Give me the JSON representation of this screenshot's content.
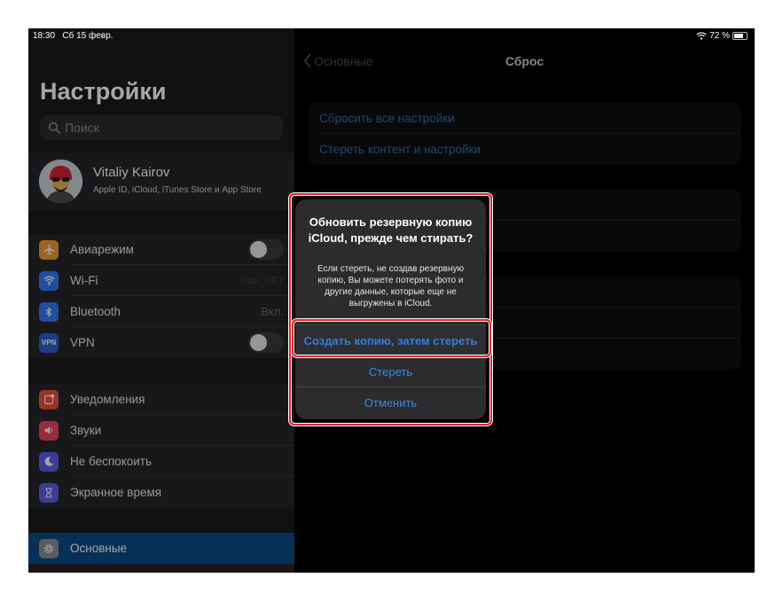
{
  "status_bar": {
    "time": "18:30",
    "date": "Сб 15 февр.",
    "battery": "72 %"
  },
  "sidebar": {
    "title": "Настройки",
    "search_placeholder": "Поиск",
    "profile": {
      "name": "Vitaliy Kairov",
      "subtitle": "Apple ID, iCloud, iTunes Store и App Store"
    },
    "group1": [
      {
        "label": "Авиарежим",
        "icon": "airplane-icon",
        "color": "#f09a37"
      },
      {
        "label": "Wi-Fi",
        "icon": "wifi-icon",
        "color": "#3478f6",
        "value": "Stan_NET"
      },
      {
        "label": "Bluetooth",
        "icon": "bluetooth-icon",
        "color": "#3478f6",
        "value": "Вкл."
      },
      {
        "label": "VPN",
        "icon": "vpn-icon",
        "color": "#2a5fd0",
        "badge": "VPN"
      }
    ],
    "group2": [
      {
        "label": "Уведомления",
        "icon": "notifications-icon",
        "color": "#eb4d3d"
      },
      {
        "label": "Звуки",
        "icon": "sounds-icon",
        "color": "#eb445a"
      },
      {
        "label": "Не беспокоить",
        "icon": "moon-icon",
        "color": "#5e5ce6"
      },
      {
        "label": "Экранное время",
        "icon": "hourglass-icon",
        "color": "#5e5ce6"
      }
    ],
    "group3": [
      {
        "label": "Основные",
        "icon": "gear-icon",
        "color": "#8e8e93"
      }
    ]
  },
  "main": {
    "back_label": "Основные",
    "title": "Сброс",
    "card1": [
      "Сбросить все настройки",
      "Стереть контент и настройки"
    ]
  },
  "alert": {
    "title": "Обновить резервную копию iCloud, прежде чем стирать?",
    "message": "Если стереть, не создав резервную копию, Вы можете потерять фото и другие данные, которые еще не выгружены в iCloud.",
    "primary": "Создать копию, затем стереть",
    "erase": "Стереть",
    "cancel": "Отменить"
  },
  "colors": {
    "accent": "#3a86e0",
    "highlight": "#e0262f",
    "selected_row": "#0a4a86"
  }
}
